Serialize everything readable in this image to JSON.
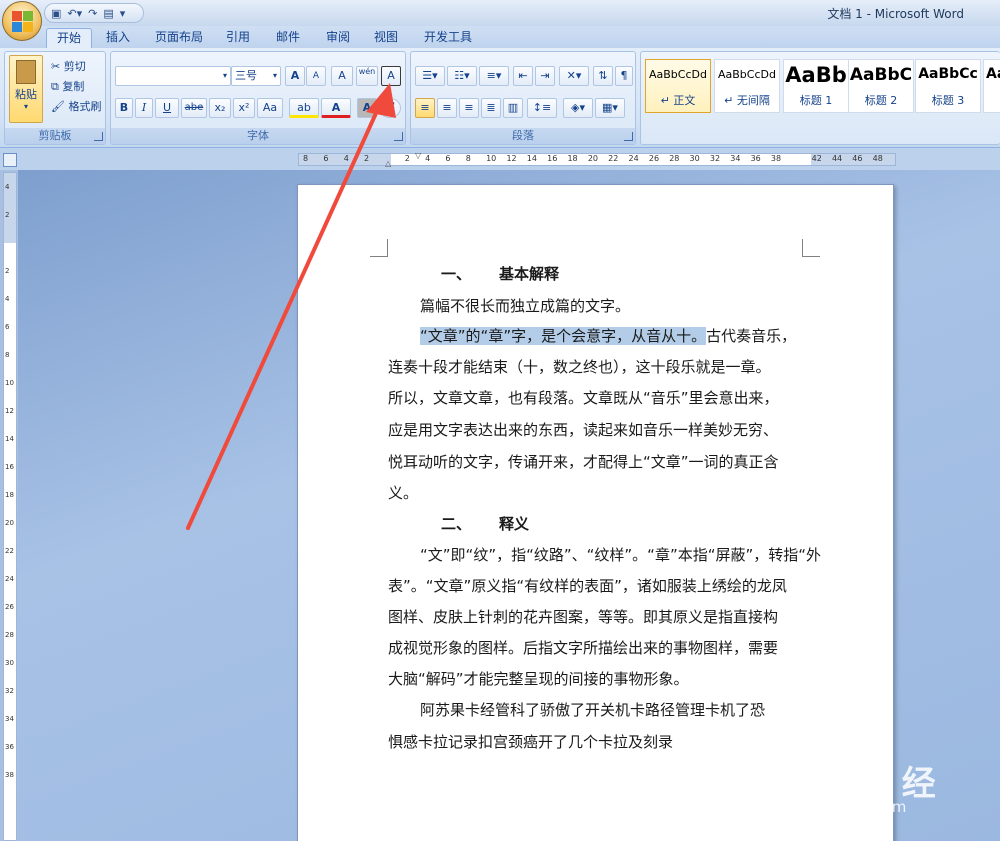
{
  "window": {
    "title": "文档 1 - Microsoft Word"
  },
  "tabs": [
    "开始",
    "插入",
    "页面布局",
    "引用",
    "邮件",
    "审阅",
    "视图",
    "开发工具"
  ],
  "clipboard": {
    "paste": "粘贴",
    "cut": "剪切",
    "copy": "复制",
    "format_painter": "格式刷",
    "group": "剪贴板"
  },
  "font": {
    "name": "",
    "size": "三号",
    "grow": "A",
    "shrink": "A",
    "clear_format": "A",
    "phonetic": "wén",
    "border_char": "A",
    "bold": "B",
    "italic": "I",
    "underline": "U",
    "strike": "abe",
    "sub": "x₂",
    "sup": "x²",
    "case": "Aa",
    "highlight": "ab",
    "color": "A",
    "shade": "A",
    "circle": "字",
    "group": "字体"
  },
  "paragraph": {
    "group": "段落"
  },
  "styles": [
    {
      "sample": "AaBbCcDd",
      "name": "↵ 正文"
    },
    {
      "sample": "AaBbCcDd",
      "name": "↵ 无间隔"
    },
    {
      "sample": "AaBb",
      "name": "标题 1"
    },
    {
      "sample": "AaBbC",
      "name": "标题 2"
    },
    {
      "sample": "AaBbCc",
      "name": "标题 3"
    },
    {
      "sample": "Aa",
      "name": ""
    }
  ],
  "ruler": {
    "h_ticks": [
      "8",
      "6",
      "4",
      "2",
      "",
      "2",
      "4",
      "6",
      "8",
      "10",
      "12",
      "14",
      "16",
      "18",
      "20",
      "22",
      "24",
      "26",
      "28",
      "30",
      "32",
      "34",
      "36",
      "38",
      "",
      "42",
      "44",
      "46",
      "48"
    ],
    "v_ticks": [
      "4",
      "2",
      "",
      "2",
      "4",
      "6",
      "8",
      "10",
      "12",
      "14",
      "16",
      "18",
      "20",
      "22",
      "24",
      "26",
      "28",
      "30",
      "32",
      "34",
      "36",
      "38"
    ]
  },
  "document": {
    "heading1_num": "一、",
    "heading1_text": "基本解释",
    "p1": "篇幅不很长而独立成篇的文字。",
    "p2_selected": "“文章”的“章”字，是个会意字，从音从十。",
    "p2_rest": "古代奏音乐，",
    "p2_l2": "连奏十段才能结束（十，数之终也），这十段乐就是一章。",
    "p2_l3": "所以，文章文章，也有段落。文章既从“音乐”里会意出来，",
    "p2_l4": "应是用文字表达出来的东西，读起来如音乐一样美妙无穷、",
    "p2_l5": "悦耳动听的文字，传诵开来，才配得上“文章”一词的真正含",
    "p2_l6": "义。",
    "heading2_num": "二、",
    "heading2_text": "释义",
    "p3_l1": "“文”即“纹”，指“纹路”、“纹样”。“章”本指“屏蔽”，转指“外",
    "p3_l2": "表”。“文章”原义指“有纹样的表面”，诸如服装上绣绘的龙凤",
    "p3_l3": "图样、皮肤上针刺的花卉图案，等等。即其原义是指直接构",
    "p3_l4": "成视觉形象的图样。后指文字所描绘出来的事物图样，需要",
    "p3_l5": "大脑“解码”才能完整呈现的间接的事物形象。",
    "p4_l1": "阿苏果卡经管科了骄傲了开关机卡路径管理卡机了恐",
    "p4_l2": "惧感卡拉记录扣宫颈癌开了几个卡拉及刻录"
  },
  "watermark": {
    "main": "Bai du 经验",
    "sub": "jingyan.baidu.com"
  },
  "colors": {
    "arrow": "#f04a3c",
    "selection": "#b3cde8",
    "ribbon": "#dae7f7"
  }
}
